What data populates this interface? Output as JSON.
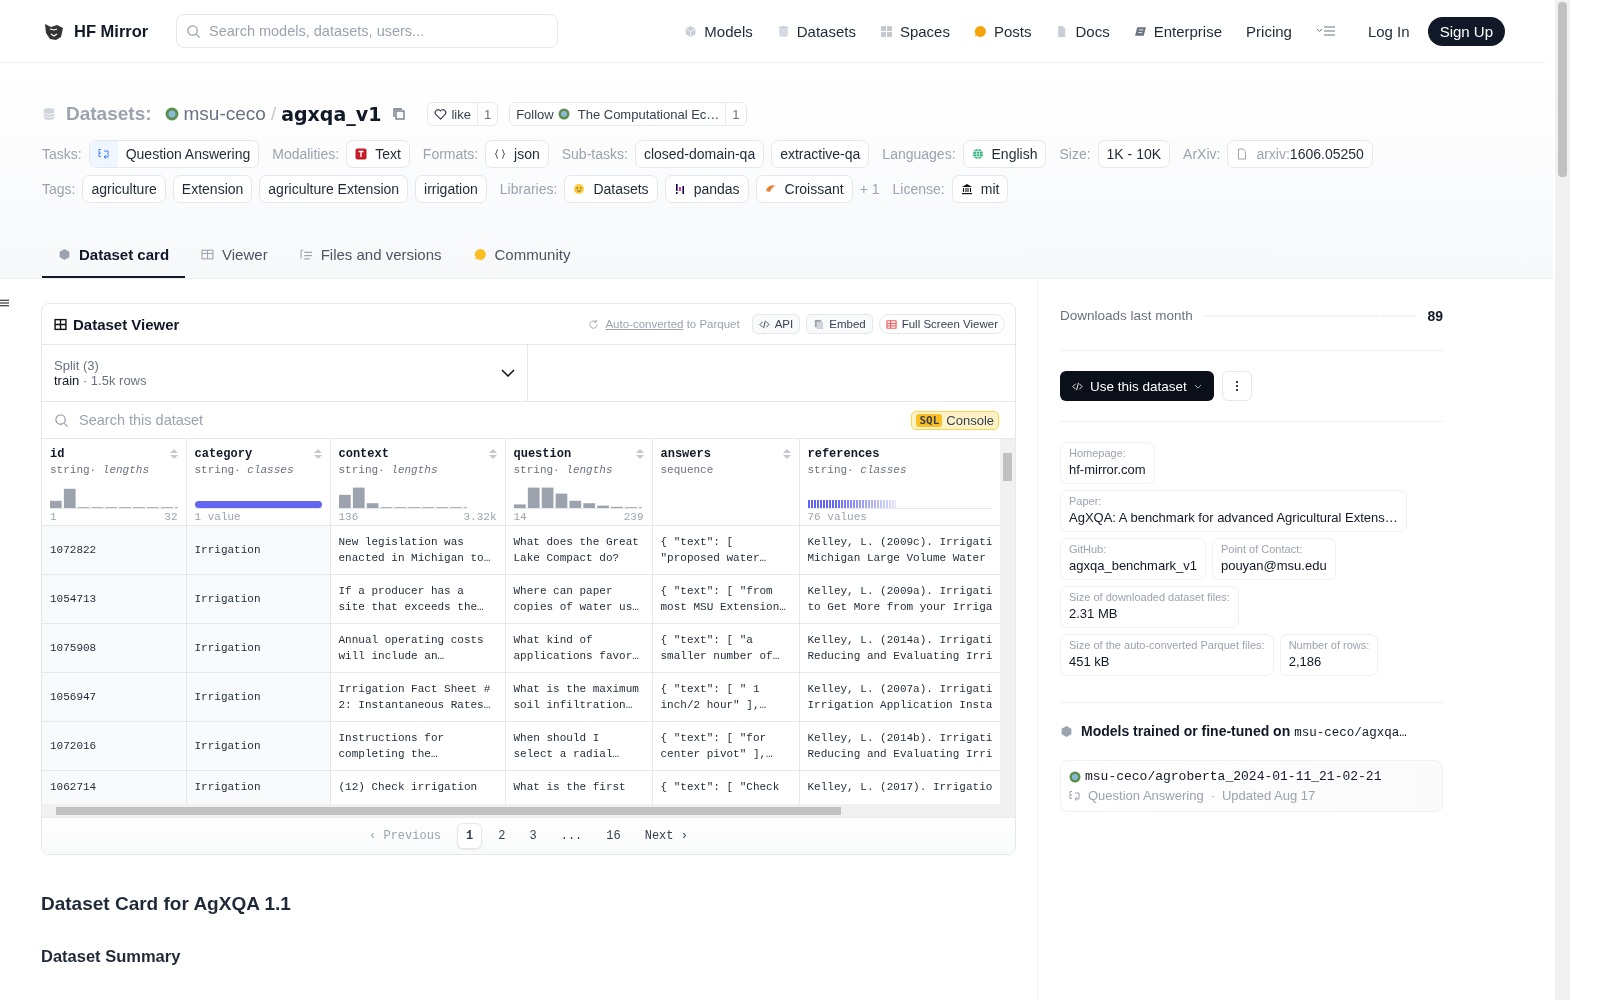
{
  "header": {
    "brand": "HF Mirror",
    "search": {
      "placeholder": "Search models, datasets, users..."
    },
    "nav": [
      {
        "label": "Models",
        "kind": "models"
      },
      {
        "label": "Datasets",
        "kind": "datasets"
      },
      {
        "label": "Spaces",
        "kind": "spaces"
      },
      {
        "label": "Posts",
        "kind": "posts"
      },
      {
        "label": "Docs",
        "kind": "docs"
      },
      {
        "label": "Enterprise",
        "kind": "enterprise"
      },
      {
        "label": "Pricing",
        "kind": "plain"
      }
    ],
    "login": "Log In",
    "signup": "Sign Up"
  },
  "repo": {
    "type_label": "Datasets:",
    "owner": "msu-ceco",
    "separator": "/",
    "name": "agxqa_v1",
    "like": {
      "label": "like",
      "count": "1"
    },
    "follow": {
      "label": "Follow",
      "org": "The Computational Ec…",
      "count": "1"
    }
  },
  "meta_rows": [
    [
      {
        "label": "Tasks:",
        "chips": [
          {
            "text": "Question Answering",
            "kind": "qa"
          }
        ]
      },
      {
        "label": "Modalities:",
        "chips": [
          {
            "text": "Text",
            "kind": "text"
          }
        ]
      },
      {
        "label": "Formats:",
        "chips": [
          {
            "text": "json",
            "kind": "json"
          }
        ]
      },
      {
        "label": "Sub-tasks:",
        "chips": [
          {
            "text": "closed-domain-qa",
            "kind": "plain"
          },
          {
            "text": "extractive-qa",
            "kind": "plain"
          }
        ]
      },
      {
        "label": "Languages:",
        "chips": [
          {
            "text": "English",
            "kind": "globe"
          }
        ]
      },
      {
        "label": "Size:",
        "chips": [
          {
            "text": "1K - 10K",
            "kind": "plain"
          }
        ]
      },
      {
        "label": "ArXiv:",
        "chips": [
          {
            "prefix": "arxiv:",
            "text": "1606.05250",
            "kind": "paper"
          }
        ]
      }
    ],
    [
      {
        "label": "Tags:",
        "chips": [
          {
            "text": "agriculture",
            "kind": "plain"
          },
          {
            "text": "Extension",
            "kind": "plain"
          },
          {
            "text": "agriculture Extension",
            "kind": "plain"
          },
          {
            "text": "irrigation",
            "kind": "plain"
          }
        ]
      },
      {
        "label": "Libraries:",
        "chips": [
          {
            "text": "Datasets",
            "kind": "hug"
          },
          {
            "text": "pandas",
            "kind": "pandas"
          },
          {
            "text": "Croissant",
            "kind": "croissant"
          }
        ],
        "more": "+ 1"
      },
      {
        "label": "License:",
        "chips": [
          {
            "text": "mit",
            "kind": "bank"
          }
        ]
      }
    ]
  ],
  "tabs": [
    {
      "label": "Dataset card",
      "kind": "card",
      "selected": true
    },
    {
      "label": "Viewer",
      "kind": "table",
      "selected": false
    },
    {
      "label": "Files and versions",
      "kind": "files",
      "selected": false
    },
    {
      "label": "Community",
      "kind": "community",
      "selected": false
    }
  ],
  "viewer": {
    "title": "Dataset Viewer",
    "converted_link": "Auto-converted",
    "converted_rest": "to Parquet",
    "buttons": [
      {
        "label": "API",
        "kind": "code"
      },
      {
        "label": "Embed",
        "kind": "embed"
      },
      {
        "label": "Full Screen Viewer",
        "kind": "full"
      }
    ],
    "split": {
      "label": "Split (3)",
      "value": "train",
      "dot": "·",
      "rows": "1.5k rows"
    },
    "search": {
      "placeholder": "Search this dataset"
    },
    "sql": {
      "badge": "SQL",
      "label": "Console"
    },
    "columns": [
      {
        "name": "id",
        "type": "string",
        "dot": "·",
        "stat": "lengths",
        "kind": "histogram",
        "min": "1",
        "max": "32"
      },
      {
        "name": "category",
        "type": "string",
        "dot": "·",
        "stat": "classes",
        "kind": "classes",
        "note": "1 value"
      },
      {
        "name": "context",
        "type": "string",
        "dot": "·",
        "stat": "lengths",
        "kind": "histogram",
        "min": "136",
        "max": "3.32k"
      },
      {
        "name": "question",
        "type": "string",
        "dot": "·",
        "stat": "lengths",
        "kind": "histogram",
        "min": "14",
        "max": "239"
      },
      {
        "name": "answers",
        "type": "sequence",
        "kind": "none"
      },
      {
        "name": "references",
        "type": "string",
        "dot": "·",
        "stat": "classes",
        "kind": "classes",
        "note": "76 values"
      }
    ],
    "rows": [
      [
        [
          "1072822"
        ],
        [
          "Irrigation"
        ],
        [
          "New legislation was",
          "enacted in Michigan to…"
        ],
        [
          "What does the Great",
          "Lake Compact do?"
        ],
        [
          "{ \"text\": [",
          "\"proposed water…"
        ],
        [
          "Kelley, L. (2009c). Irrigati",
          "Michigan Large Volume Water"
        ]
      ],
      [
        [
          "1054713"
        ],
        [
          "Irrigation"
        ],
        [
          "If a producer has a",
          "site that exceeds the…"
        ],
        [
          "Where can paper",
          "copies of water us…"
        ],
        [
          "{ \"text\": [ \"from",
          "most MSU Extension…"
        ],
        [
          "Kelley, L. (2009a). Irrigati",
          "to Get More from your Irriga"
        ]
      ],
      [
        [
          "1075908"
        ],
        [
          "Irrigation"
        ],
        [
          "Annual operating costs",
          "will include an…"
        ],
        [
          "What kind of",
          "applications favor…"
        ],
        [
          "{ \"text\": [ \"a",
          "smaller number of…"
        ],
        [
          "Kelley, L. (2014a). Irrigati",
          "Reducing and Evaluating Irri"
        ]
      ],
      [
        [
          "1056947"
        ],
        [
          "Irrigation"
        ],
        [
          "Irrigation Fact Sheet #",
          "2: Instantaneous Rates…"
        ],
        [
          "What is the maximum",
          "soil infiltration…"
        ],
        [
          "{ \"text\": [ \" 1",
          "inch/2 hour\" ],…"
        ],
        [
          "Kelley, L. (2007a). Irrigati",
          "Irrigation Application Insta"
        ]
      ],
      [
        [
          "1072016"
        ],
        [
          "Irrigation"
        ],
        [
          "Instructions for",
          "completing the…"
        ],
        [
          "When should I",
          "select a radial…"
        ],
        [
          "{ \"text\": [ \"for",
          "center pivot\" ],…"
        ],
        [
          "Kelley, L. (2014b). Irrigati",
          "Reducing and Evaluating Irri"
        ]
      ],
      [
        [
          "1062714"
        ],
        [
          "Irrigation"
        ],
        [
          "(12) Check irrigation"
        ],
        [
          "What is the first"
        ],
        [
          "{ \"text\": [ \"Check"
        ],
        [
          "Kelley, L. (2017). Irrigatio"
        ]
      ]
    ],
    "pages": [
      {
        "label": "‹ Previous",
        "kind": "prev",
        "selected": false
      },
      {
        "label": "1",
        "kind": "page",
        "selected": true
      },
      {
        "label": "2",
        "kind": "page",
        "selected": false
      },
      {
        "label": "3",
        "kind": "page",
        "selected": false
      },
      {
        "label": "...",
        "kind": "gap",
        "selected": false
      },
      {
        "label": "16",
        "kind": "page",
        "selected": false
      },
      {
        "label": "Next ›",
        "kind": "next",
        "selected": false
      }
    ]
  },
  "card": {
    "title": "Dataset Card for AgXQA 1.1",
    "section": "Dataset Summary"
  },
  "sidebar": {
    "downloads": {
      "label": "Downloads last month",
      "value": "89"
    },
    "use_button": "Use this dataset",
    "info": [
      [
        {
          "label": "Homepage:",
          "value": "hf-mirror.com"
        }
      ],
      [
        {
          "label": "Paper:",
          "value": "AgXQA: A benchmark for advanced Agricultural Extens…"
        }
      ],
      [
        {
          "label": "GitHub:",
          "value": "agxqa_benchmark_v1"
        },
        {
          "label": "Point of Contact:",
          "value": "pouyan@msu.edu"
        }
      ],
      [
        {
          "label": "Size of downloaded dataset files:",
          "value": "2.31 MB"
        }
      ],
      [
        {
          "label": "Size of the auto-converted Parquet files:",
          "value": "451 kB"
        },
        {
          "label": "Number of rows:",
          "value": "2,186"
        }
      ]
    ],
    "models": {
      "title": "Models trained or fine-tuned on",
      "repo": "msu-ceco/agxqa…",
      "items": [
        {
          "name": "msu-ceco/agroberta_2024-01-11_21-02-21",
          "task": "Question Answering",
          "dot": "·",
          "updated": "Updated Aug 17"
        }
      ]
    }
  }
}
